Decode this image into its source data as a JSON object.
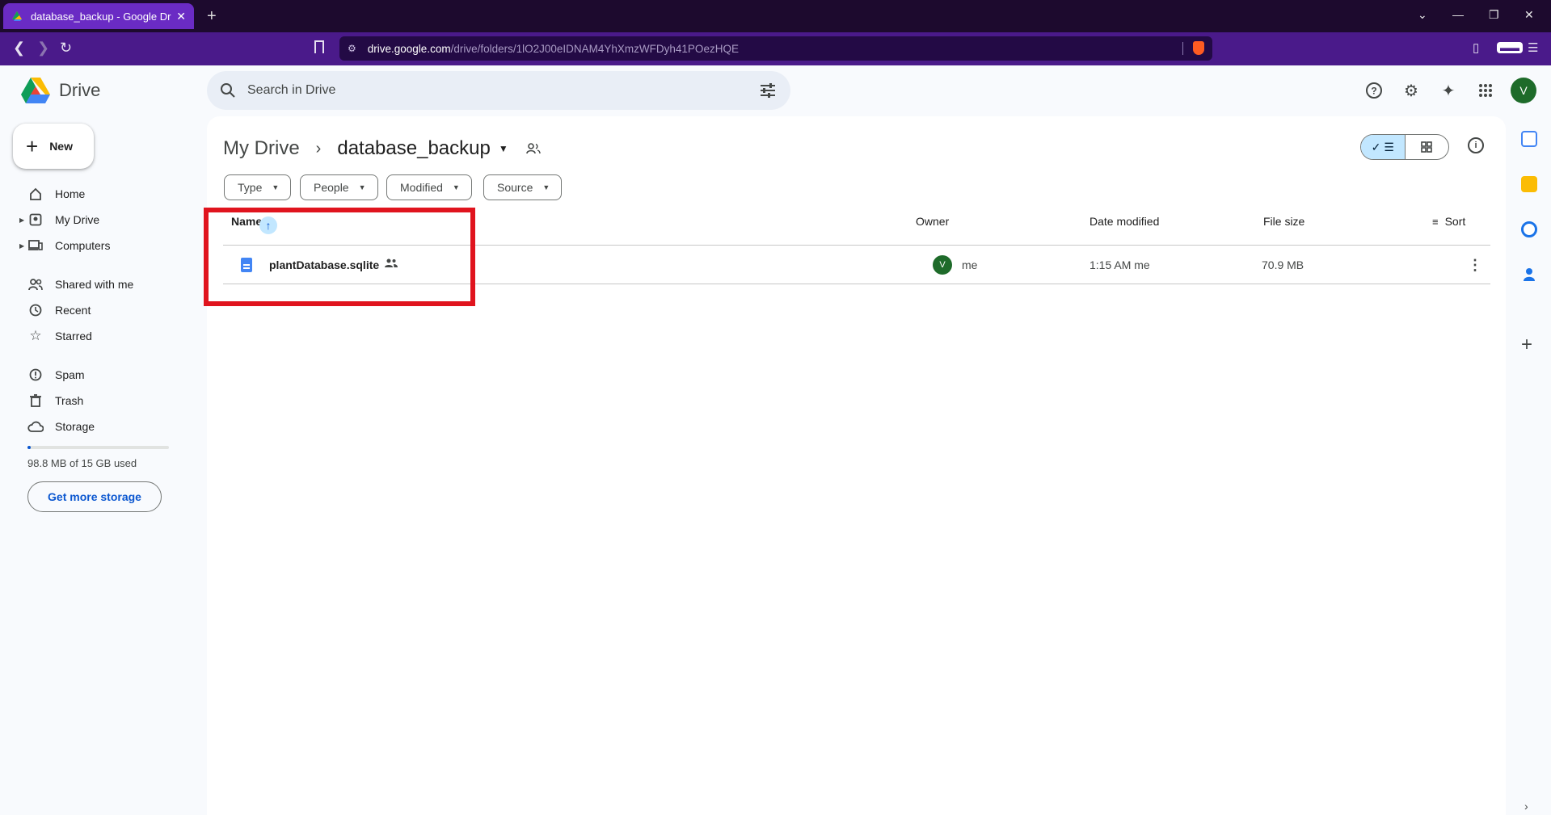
{
  "browser": {
    "tab_title": "database_backup - Google Drive",
    "url_host": "drive.google.com",
    "url_path": "/drive/folders/1lO2J00eIDNAM4YhXmzWFDyh41POezHQE"
  },
  "app": {
    "name": "Drive",
    "search_placeholder": "Search in Drive",
    "avatar_letter": "V"
  },
  "sidebar": {
    "new_label": "New",
    "items": [
      {
        "label": "Home",
        "icon": "home-icon"
      },
      {
        "label": "My Drive",
        "icon": "my-drive-icon"
      },
      {
        "label": "Computers",
        "icon": "computers-icon"
      },
      {
        "label": "Shared with me",
        "icon": "shared-with-me-icon"
      },
      {
        "label": "Recent",
        "icon": "clock-icon"
      },
      {
        "label": "Starred",
        "icon": "star-icon"
      },
      {
        "label": "Spam",
        "icon": "spam-icon"
      },
      {
        "label": "Trash",
        "icon": "trash-icon"
      },
      {
        "label": "Storage",
        "icon": "cloud-icon"
      }
    ],
    "storage_used_text": "98.8 MB of 15 GB used",
    "storage_fraction": 0.0064,
    "get_storage_label": "Get more storage"
  },
  "main": {
    "breadcrumb_root": "My Drive",
    "breadcrumb_current": "database_backup",
    "filters": [
      "Type",
      "People",
      "Modified",
      "Source"
    ],
    "columns": {
      "name": "Name",
      "owner": "Owner",
      "date": "Date modified",
      "size": "File size",
      "sort": "Sort"
    },
    "files": [
      {
        "name": "plantDatabase.sqlite",
        "owner_initial": "V",
        "owner": "me",
        "date_modified": "1:15 AM me",
        "file_size": "70.9 MB"
      }
    ]
  },
  "colors": {
    "accent": "#0b57d0",
    "highlight_box": "#e0141e",
    "tab_active": "#6a2bc4"
  }
}
